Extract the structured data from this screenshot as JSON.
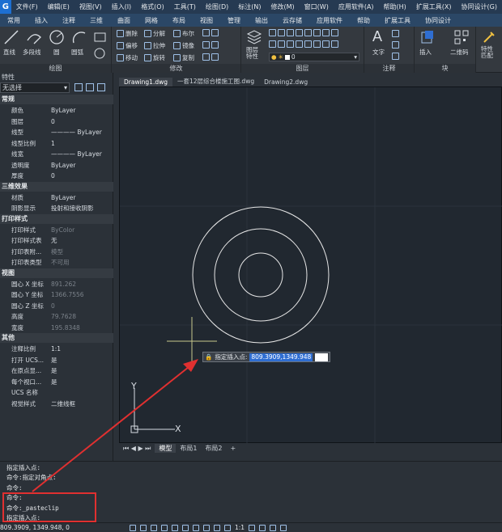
{
  "menubar": {
    "logo": "G",
    "items": [
      "文件(F)",
      "编辑(E)",
      "视图(V)",
      "插入(I)",
      "格式(O)",
      "工具(T)",
      "绘图(D)",
      "标注(N)",
      "修改(M)",
      "窗口(W)",
      "应用软件(A)",
      "帮助(H)",
      "扩展工具(X)",
      "协同设计(G)"
    ]
  },
  "ribbon_tabs": [
    "常用",
    "插入",
    "注释",
    "三维",
    "曲面",
    "网格",
    "布局",
    "视图",
    "管理",
    "输出",
    "云存储",
    "应用软件",
    "帮助",
    "扩展工具",
    "协同设计"
  ],
  "ribbon": {
    "draw": {
      "title": "绘图",
      "line": "直线",
      "polyline": "多段线",
      "circle": "圆",
      "arc": "圆弧"
    },
    "modify": {
      "title": "修改",
      "erase": "删除",
      "explode": "分解",
      "mirror_copy": "布尔",
      "offset": "偏移",
      "stretch": "拉伸",
      "mirror": "镜像",
      "move": "移动",
      "rotate": "旋转",
      "copy": "复制"
    },
    "layers": {
      "title": "图层",
      "props": "图层\n特性",
      "current": "0"
    },
    "annotation": {
      "title": "注释",
      "text": "文字"
    },
    "block": {
      "title": "块",
      "insert": "插入",
      "qrcode": "二维码"
    },
    "match": {
      "label": "特性\n匹配"
    }
  },
  "panel": {
    "title": "特性",
    "selector": "无选择",
    "sections": {
      "general": "常规",
      "threed": "三维效果",
      "print": "打印样式",
      "view": "视图",
      "misc": "其他"
    },
    "general_rows": [
      {
        "k": "颜色",
        "v": "ByLayer"
      },
      {
        "k": "图层",
        "v": "0"
      },
      {
        "k": "线型",
        "v": "———— ByLayer"
      },
      {
        "k": "线型比例",
        "v": "1"
      },
      {
        "k": "线宽",
        "v": "———— ByLayer"
      },
      {
        "k": "透明度",
        "v": "ByLayer"
      },
      {
        "k": "厚度",
        "v": "0"
      }
    ],
    "threed_rows": [
      {
        "k": "材质",
        "v": "ByLayer"
      },
      {
        "k": "阴影显示",
        "v": "投射和接收阴影"
      }
    ],
    "print_rows": [
      {
        "k": "打印样式",
        "v": "ByColor"
      },
      {
        "k": "打印样式表",
        "v": "无"
      },
      {
        "k": "打印表附...",
        "v": "模型"
      },
      {
        "k": "打印表类型",
        "v": "不可用"
      }
    ],
    "view_rows": [
      {
        "k": "圆心 X 坐标",
        "v": "891.262"
      },
      {
        "k": "圆心 Y 坐标",
        "v": "1366.7556"
      },
      {
        "k": "圆心 Z 坐标",
        "v": "0"
      },
      {
        "k": "高度",
        "v": "79.7628"
      },
      {
        "k": "宽度",
        "v": "195.8348"
      }
    ],
    "misc_rows": [
      {
        "k": "注释比例",
        "v": "1:1"
      },
      {
        "k": "打开 UCS...",
        "v": "是"
      },
      {
        "k": "在原点显...",
        "v": "是"
      },
      {
        "k": "每个视口...",
        "v": "是"
      },
      {
        "k": "UCS 名称",
        "v": ""
      },
      {
        "k": "视觉样式",
        "v": "二维线框"
      }
    ]
  },
  "doc_tabs": [
    "Drawing1.dwg",
    "一套12层综合楼施工图.dwg",
    "Drawing2.dwg"
  ],
  "layout_tabs": [
    "模型",
    "布局1",
    "布局2",
    "+"
  ],
  "insert_prompt": {
    "label": "指定插入点:",
    "value": "809.3909,1349.948"
  },
  "ucs": {
    "x": "X",
    "y": "Y"
  },
  "command_lines": [
    "指定插入点:",
    "命令:指定对角点:",
    "命令:",
    "命令:",
    "命令:_pasteclip",
    "指定插入点:"
  ],
  "status": {
    "coords": "809.3909, 1349.948, 0",
    "scale": "1:1"
  },
  "colors": {
    "highlight": "#e03030",
    "accent": "#2f6ed2",
    "drawing": "#e6e6e6"
  }
}
